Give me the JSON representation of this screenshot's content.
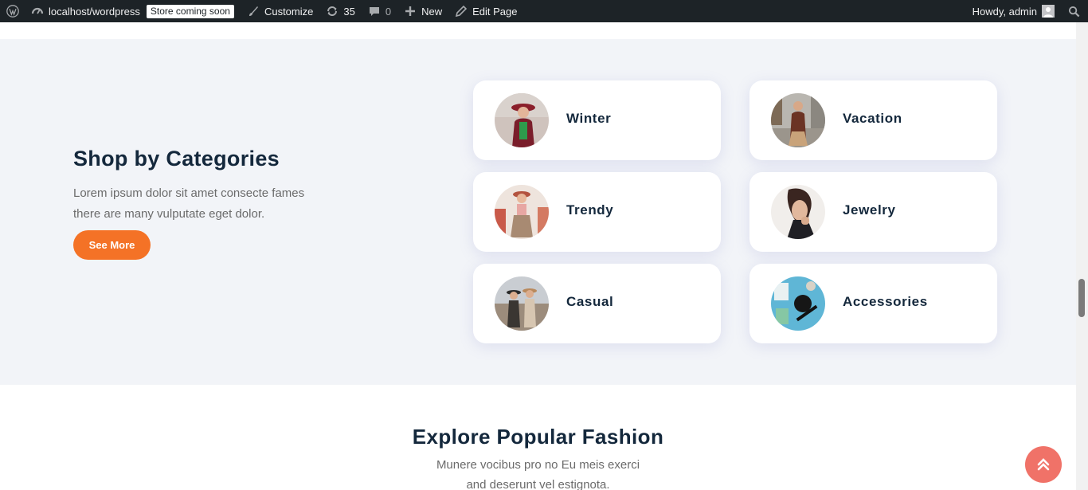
{
  "adminbar": {
    "site": "localhost/wordpress",
    "badge": "Store coming soon",
    "customize": "Customize",
    "updates_count": "35",
    "comments_count": "0",
    "new": "New",
    "edit_page": "Edit Page",
    "howdy": "Howdy, admin"
  },
  "categories": {
    "title": "Shop by Categories",
    "description": "Lorem ipsum dolor sit amet consecte fames there are many vulputate eget dolor.",
    "button": "See More",
    "items": [
      {
        "label": "Winter"
      },
      {
        "label": "Vacation"
      },
      {
        "label": "Trendy"
      },
      {
        "label": "Jewelry"
      },
      {
        "label": "Casual"
      },
      {
        "label": "Accessories"
      }
    ]
  },
  "explore": {
    "title": "Explore Popular Fashion",
    "subtitle_line1": "Munere vocibus pro no Eu meis exerci",
    "subtitle_line2": "and deserunt vel estignota."
  },
  "colors": {
    "accent": "#f47226",
    "heading": "#14283c",
    "section_bg": "#f2f4f8",
    "scroll_top": "#f07268"
  },
  "icons": {
    "wp_logo": "wordpress-icon",
    "dashboard": "dashboard-icon",
    "customize": "brush-icon",
    "updates": "refresh-icon",
    "comments": "comment-icon",
    "new": "plus-icon",
    "edit": "pencil-icon",
    "search": "search-icon",
    "scroll_top": "double-chevron-up-icon"
  }
}
